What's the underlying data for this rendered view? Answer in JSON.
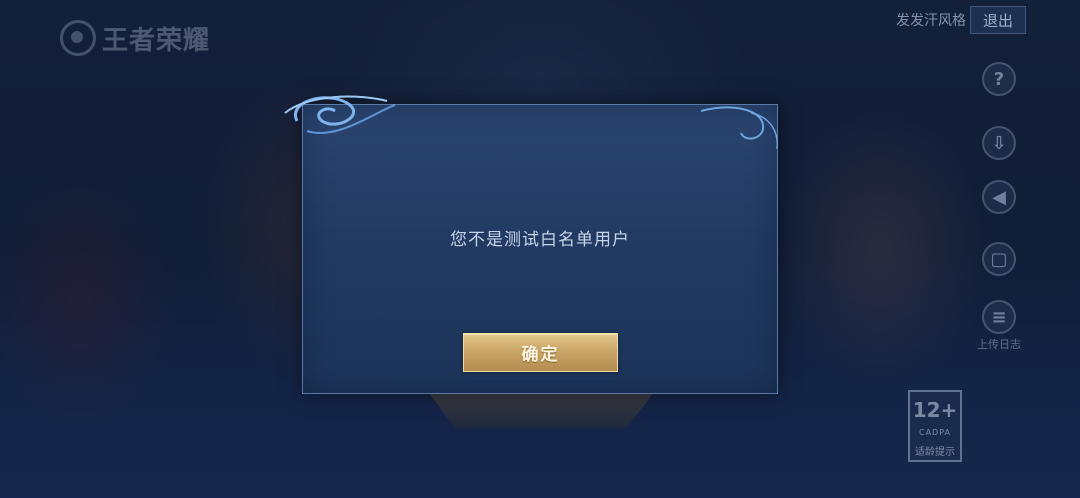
{
  "header": {
    "logo_text": "王者荣耀",
    "account_name": "发发汗风格",
    "logout_label": "退出"
  },
  "side_tools": [
    {
      "icon": "help-icon",
      "glyph": "?",
      "label": ""
    },
    {
      "icon": "download-icon",
      "glyph": "⇩",
      "label": ""
    },
    {
      "icon": "speaker-icon",
      "glyph": "◀",
      "label": ""
    },
    {
      "icon": "card-icon",
      "glyph": "▢",
      "label": ""
    },
    {
      "icon": "log-icon",
      "glyph": "≡",
      "label": "上传日志"
    }
  ],
  "age_rating": {
    "value": "12+",
    "org": "CADPA",
    "tip": "适龄提示"
  },
  "dialog": {
    "message": "您不是测试白名单用户",
    "confirm_label": "确定"
  },
  "colors": {
    "dialog_bg": "#223b62",
    "dialog_border": "#5b7aa8",
    "button_gold": "#c9a566"
  }
}
